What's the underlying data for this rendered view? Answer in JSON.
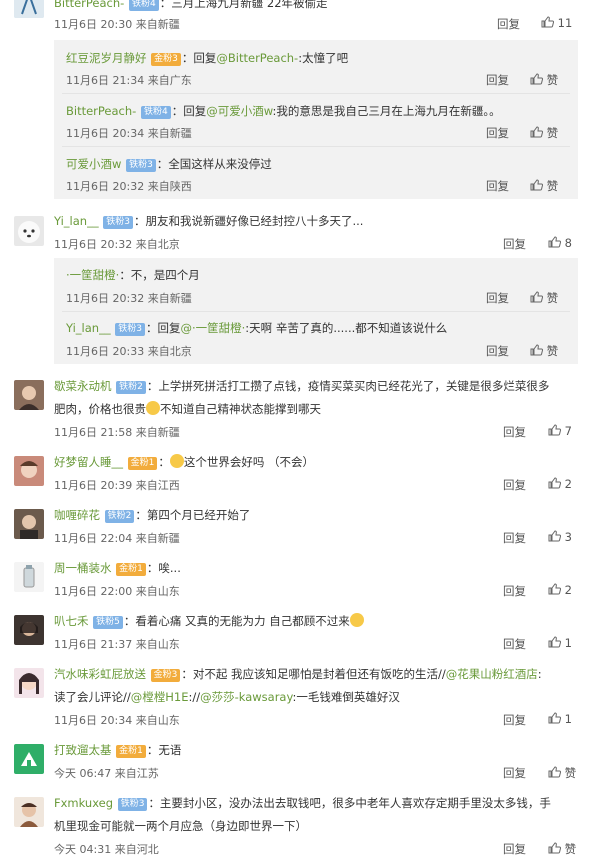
{
  "comments": [
    {
      "name": "BitterPeach-",
      "badge": "铁粉4",
      "text": "：三月上海九月新疆 22年被偷走",
      "time": "11月6日 20:30 来自新疆",
      "likes": "11"
    },
    {
      "name": "Yi_lan__",
      "badge": "铁粉3",
      "text": "：朋友和我说新疆好像已经封控八十多天了...",
      "time": "11月6日 20:32 来自北京",
      "likes": "8"
    },
    {
      "name": "歇菜永动机",
      "badge": "铁粉2",
      "text": "：上学拼死拼活打工攒了点钱，疫情买菜买肉已经花光了，关键是很多烂菜很多",
      "text2": "肥肉，价格也很贵",
      "text3": "不知道自己精神状态能撑到哪天",
      "time": "11月6日 21:58 来自新疆",
      "likes": "7"
    },
    {
      "name": "好梦留人睡__",
      "badge": "金粉1",
      "text": "：",
      "text2": "这个世界会好吗 （不会）",
      "time": "11月6日 20:39 来自江西",
      "likes": "2"
    },
    {
      "name": "咖喱碎花",
      "badge": "铁粉2",
      "text": "：第四个月已经开始了",
      "time": "11月6日 22:04 来自新疆",
      "likes": "3"
    },
    {
      "name": "周一桶装水",
      "badge": "金粉1",
      "text": "：唉...",
      "time": "11月6日 22:00 来自山东",
      "likes": "2"
    },
    {
      "name": "叭七禾",
      "badge": "铁粉5",
      "text": "：看着心痛 又真的无能为力 自己都顾不过来",
      "time": "11月6日 21:37 来自山东",
      "likes": "1"
    },
    {
      "name": "汽水味彩虹屁放送",
      "badge": "金粉3",
      "text": "：对不起 我应该知足哪怕是封着但还有饭吃的生活//",
      "m1": "@花果山粉红酒店",
      "t1": ":",
      "text2": "读了会儿评论//",
      "m2": "@樘樘H1E",
      "t2": "://",
      "m3": "@莎莎-kawsaray",
      "t3": ":一毛钱难倒英雄好汉",
      "time": "11月6日 20:34 来自山东",
      "likes": "1"
    },
    {
      "name": "打致遛太基",
      "badge": "金粉1",
      "text": "：无语",
      "time": "今天 06:47 来自江苏",
      "likes": "赞"
    },
    {
      "name": "Fxmkuxeg",
      "badge": "铁粉3",
      "text": "：主要封小区，没办法出去取钱吧，很多中老年人喜欢存定期手里没太多钱，手",
      "text2": "机里现金可能就一两个月应急（身边即世界一下）",
      "time": "今天 04:31 来自河北",
      "likes": "赞"
    }
  ],
  "replies": [
    {
      "name": "红豆泥岁月静好",
      "badge": "金粉3",
      "text": "：回复",
      "mention": "@BitterPeach-",
      "tail": ":太憧了吧",
      "time": "11月6日 21:34 来自广东",
      "likes": "赞"
    },
    {
      "name": "BitterPeach-",
      "badge": "铁粉4",
      "text": "：回复",
      "mention": "@可爱小酒w",
      "tail": ":我的意思是我自己三月在上海九月在新疆。。",
      "time": "11月6日 20:34 来自新疆",
      "likes": "赞"
    },
    {
      "name": "可爱小酒w",
      "badge": "铁粉3",
      "text": "：全国这样从来没停过",
      "time": "11月6日 20:32 来自陕西",
      "likes": "赞"
    },
    {
      "name": "·一筐甜橙·",
      "text": "：不，是四个月",
      "time": "11月6日 20:32 来自新疆",
      "likes": "赞"
    },
    {
      "name": "Yi_lan__",
      "badge": "铁粉3",
      "text": "：回复",
      "mention": "@·一筐甜橙·",
      "tail": ":天啊 辛苦了真的......都不知道该说什么",
      "time": "11月6日 20:33 来自北京",
      "likes": "赞"
    }
  ],
  "labels": {
    "reply": "回复"
  },
  "colors": {
    "name": "#6a9a3a",
    "iron_badge": "#7fb2e6",
    "gold_badge": "#f2ac3c",
    "reply_bg": "#f2f2f2"
  }
}
